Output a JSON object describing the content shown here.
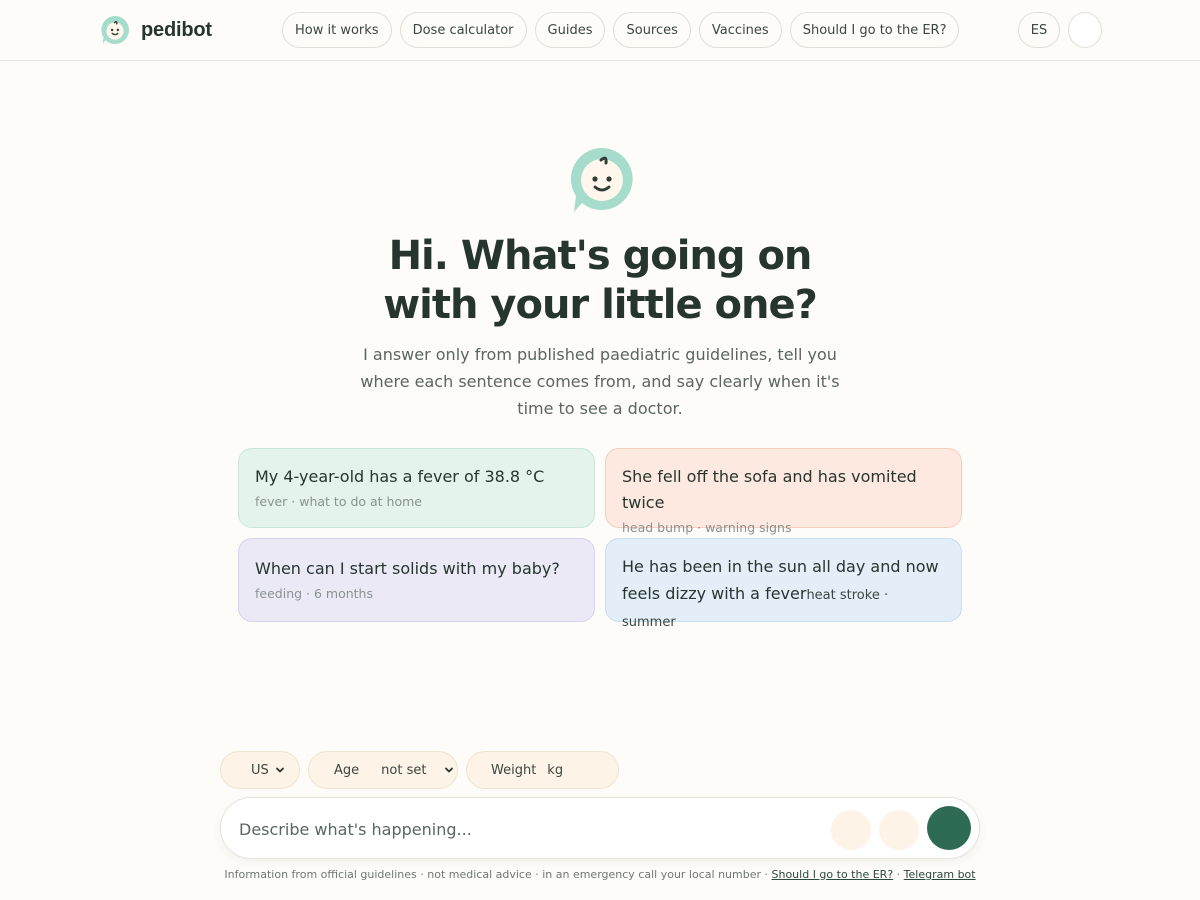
{
  "header": {
    "brand_name": "pedibot",
    "nav": [
      {
        "label": "How it works"
      },
      {
        "label": "Dose calculator"
      },
      {
        "label": "Guides"
      },
      {
        "label": "Sources"
      },
      {
        "label": "Vaccines"
      },
      {
        "label": "Should I go to the ER?"
      }
    ],
    "language": "ES"
  },
  "hero": {
    "title_line1": "Hi. What's going on",
    "title_line2": "with your little one?",
    "subtitle": "I answer only from published paediatric guidelines, tell you where each sentence comes from, and say clearly when it's time to see a doctor."
  },
  "suggestions": [
    {
      "text": "My 4-year-old has a fever of 38.8 °C",
      "tags": "fever · what to do at home"
    },
    {
      "text": "She fell off the sofa and has vomited twice",
      "tags": "head bump · warning signs"
    },
    {
      "text": "When can I start solids with my baby?",
      "tags": "feeding · 6 months"
    },
    {
      "text": "He has been in the sun all day and now feels dizzy with a fever",
      "tags": "heat stroke · summer"
    }
  ],
  "settings": {
    "country": "US",
    "age_label": "Age",
    "age_value": "not set",
    "weight_label": "Weight",
    "weight_unit": "kg"
  },
  "composer": {
    "placeholder": "Describe what's happening..."
  },
  "footer": {
    "text": "Information from official guidelines · not medical advice · in an emergency call your local number · ",
    "er_link": "Should I go to the ER?",
    "separator": " · ",
    "telegram_link": "Telegram bot"
  },
  "colors": {
    "background": "#fdfcf8",
    "primary": "#2e6b54",
    "logo_mint": "#a6dccb",
    "card_green": "#e4f3ec",
    "card_peach": "#fde9df",
    "card_lavender": "#ebe9f6",
    "card_blue": "#e4eef9"
  },
  "icons": {
    "logo": "baby-face-speech-bubble-icon",
    "chevron": "chevron-down-icon"
  }
}
